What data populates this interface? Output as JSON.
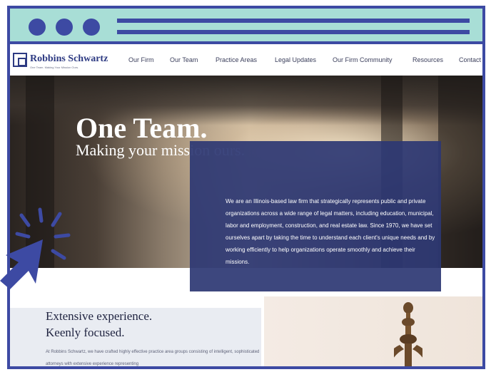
{
  "colors": {
    "frame": "#3d4aa3",
    "chrome": "#a8ded6",
    "brand": "#2d3a82",
    "card": "#2d3773"
  },
  "site": {
    "logo_name": "Robbins Schwartz",
    "logo_tagline": "One Team. Making Your Mission Ours.",
    "nav": [
      "Our Firm",
      "Our Team",
      "Practice Areas",
      "Legal Updates",
      "Our Firm Community",
      "Resources",
      "Contact"
    ]
  },
  "hero": {
    "title": "One Team.",
    "subtitle": "Making your mission ours.",
    "body": "We are an Illinois-based law firm that strategically represents public and private organizations across a wide range of legal matters, including education, municipal, labor and employment, construction, and real estate law. Since 1970, we have set ourselves apart by taking the time to understand each client's unique needs and by working efficiently to help organizations operate smoothly and achieve their missions."
  },
  "section": {
    "heading_line1": "Extensive experience.",
    "heading_line2": "Keenly focused.",
    "body": "At Robbins Schwartz, we have crafted highly effective practice area groups consisting of intelligent, sophisticated attorneys with extensive experience representing"
  },
  "icons": {
    "cursor": "arrow-cursor-icon",
    "burst": "click-burst-icon"
  }
}
